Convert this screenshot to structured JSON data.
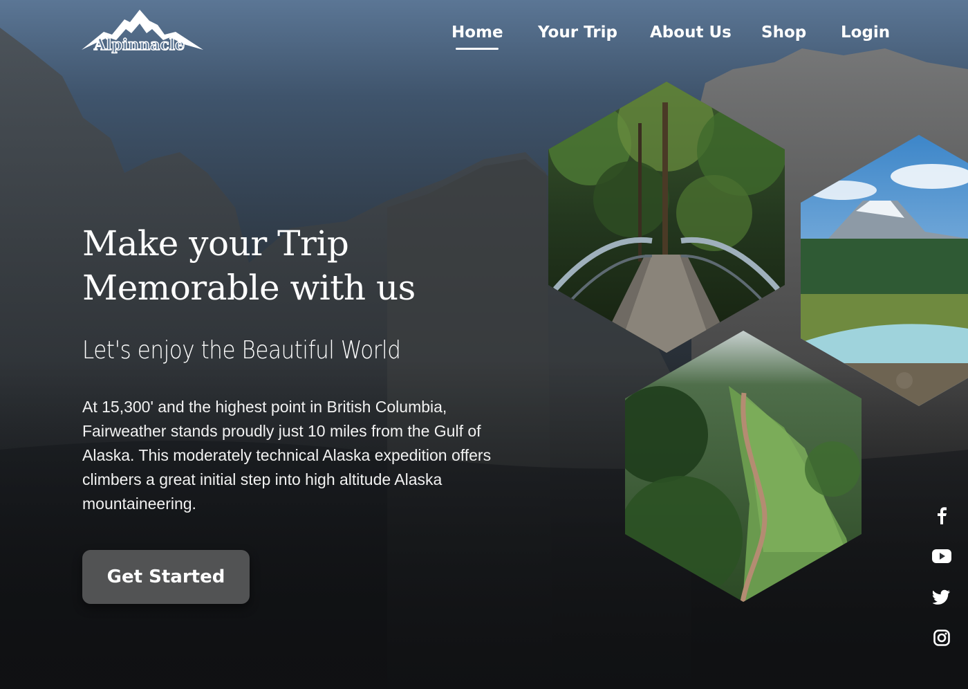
{
  "brand": {
    "logo_text": "Alpinnacle"
  },
  "nav": {
    "items": [
      "Home",
      "Your Trip",
      "About Us",
      "Shop",
      "Login"
    ],
    "active": "Home"
  },
  "hero": {
    "headline_line1": "Make your Trip",
    "headline_line2": "Memorable with us",
    "subheadline": "Let's enjoy the Beautiful World",
    "paragraph": "At 15,300' and the highest point in British Columbia, Fairweather stands proudly just 10 miles from the Gulf of Alaska. This moderately technical Alaska expedition offers climbers a great initial step into high altitude Alaska mountaineering.",
    "cta_label": "Get Started"
  },
  "gallery": {
    "images": [
      "forest-bridge-photo",
      "mountain-river-photo",
      "green-ridge-trail-photo"
    ]
  },
  "social": {
    "icons": [
      "facebook-icon",
      "youtube-icon",
      "twitter-icon",
      "instagram-icon"
    ]
  },
  "colors": {
    "button_bg": "#525354",
    "text": "#ffffff",
    "sky_top": "#5b7695",
    "ground": "#111214"
  }
}
